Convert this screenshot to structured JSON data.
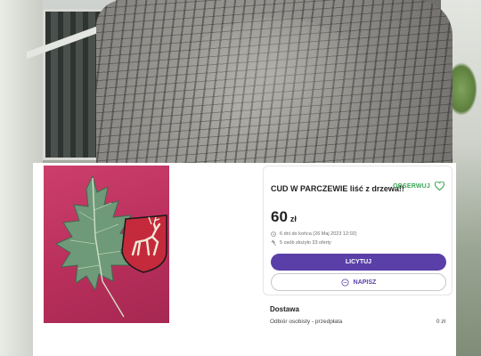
{
  "listing": {
    "title": "CUD W PARCZEWIE liść z drzewa!!",
    "watch_label": "OBSERWUJ",
    "price": "60",
    "currency": "zł",
    "ends_info": "6 dni do końca (26 Maj 2023 12:02)",
    "bids_info": "5 osób złożyło 33 oferty",
    "bid_button": "LICYTUJ",
    "message_button": "NAPISZ"
  },
  "delivery": {
    "heading": "Dostawa",
    "option_label": "Odbiór osobisty - przedpłata",
    "option_cost": "0 zł"
  },
  "colors": {
    "accent": "#5a3fa8",
    "watch_green": "#3aa655",
    "photo_red": "#b92f5c"
  },
  "icons": {
    "watch": "heart-outline-icon",
    "clock": "clock-icon",
    "bids": "gavel-icon",
    "message": "chat-bubble-icon"
  }
}
